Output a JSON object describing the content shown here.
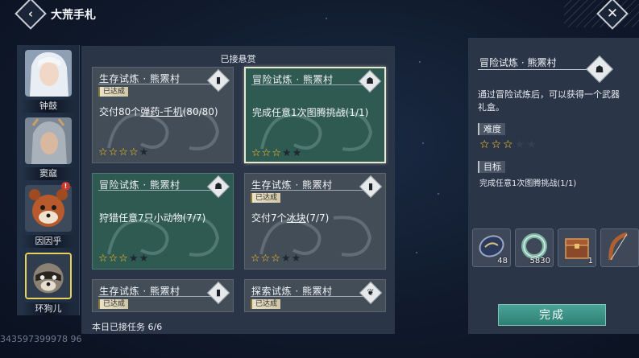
{
  "header": {
    "title": "大荒手札",
    "back_icon": "back-arrow-icon",
    "close_icon": "close-icon"
  },
  "characters": [
    {
      "name": "钟鼓",
      "selected": false,
      "alert": false
    },
    {
      "name": "窦窳",
      "selected": false,
      "alert": false
    },
    {
      "name": "因因乎",
      "selected": false,
      "alert": true,
      "alert_text": "!"
    },
    {
      "name": "环狗儿",
      "selected": true,
      "alert": false
    }
  ],
  "board": {
    "heading": "已接悬赏",
    "daily_count": "本日已接任务 6/6",
    "cards": [
      {
        "title": "生存试炼 · 熊罴村",
        "status": "已达成",
        "task_prefix": "交付80个",
        "task_link": "弹药-千机",
        "task_suffix": "(80/80)",
        "stars": 4,
        "max_stars": 5,
        "icon": "scroll-icon",
        "icon_glyph": "▮",
        "theme": "grey"
      },
      {
        "title": "冒险试炼 · 熊罴村",
        "status": "",
        "task_prefix": "完成任意1次图腾挑战(1/1)",
        "task_link": "",
        "task_suffix": "",
        "stars": 3,
        "max_stars": 5,
        "icon": "bear-mask-icon",
        "icon_glyph": "☗",
        "theme": "green"
      },
      {
        "title": "冒险试炼 · 熊罴村",
        "status": "",
        "task_prefix": "狩猎任意7只小动物(7/7)",
        "task_link": "",
        "task_suffix": "",
        "stars": 3,
        "max_stars": 5,
        "icon": "bear-mask-icon",
        "icon_glyph": "☗",
        "theme": "green"
      },
      {
        "title": "生存试炼 · 熊罴村",
        "status": "已达成",
        "task_prefix": "交付7个",
        "task_link": "冰块",
        "task_suffix": "(7/7)",
        "stars": 3,
        "max_stars": 5,
        "icon": "scroll-icon",
        "icon_glyph": "▮",
        "theme": "grey"
      },
      {
        "title": "生存试炼 · 熊罴村",
        "status": "已达成",
        "task_prefix": "",
        "task_link": "",
        "task_suffix": "",
        "stars": 0,
        "max_stars": 0,
        "icon": "scroll-icon",
        "icon_glyph": "▮",
        "theme": "grey"
      },
      {
        "title": "探索试炼 · 熊罴村",
        "status": "已达成",
        "task_prefix": "",
        "task_link": "",
        "task_suffix": "",
        "stars": 0,
        "max_stars": 0,
        "icon": "footprint-icon",
        "icon_glyph": "❦",
        "theme": "grey"
      }
    ]
  },
  "detail": {
    "title": "冒险试炼 · 熊罴村",
    "icon_glyph": "☗",
    "description": "通过冒险试炼后，可以获得一个武器礼盒。",
    "difficulty_label": "难度",
    "difficulty_stars": 3,
    "difficulty_max": 5,
    "goal_label": "目标",
    "goal_text": "完成任意1次图腾挑战(1/1)",
    "rewards": [
      {
        "icon": "coin-medal-icon",
        "qty": "48"
      },
      {
        "icon": "jade-ring-icon",
        "qty": "5830"
      },
      {
        "icon": "treasure-chest-icon",
        "qty": "1"
      },
      {
        "icon": "bow-weapon-icon",
        "qty": ""
      }
    ],
    "complete_label": "完成"
  },
  "uid": "343597399978 96"
}
